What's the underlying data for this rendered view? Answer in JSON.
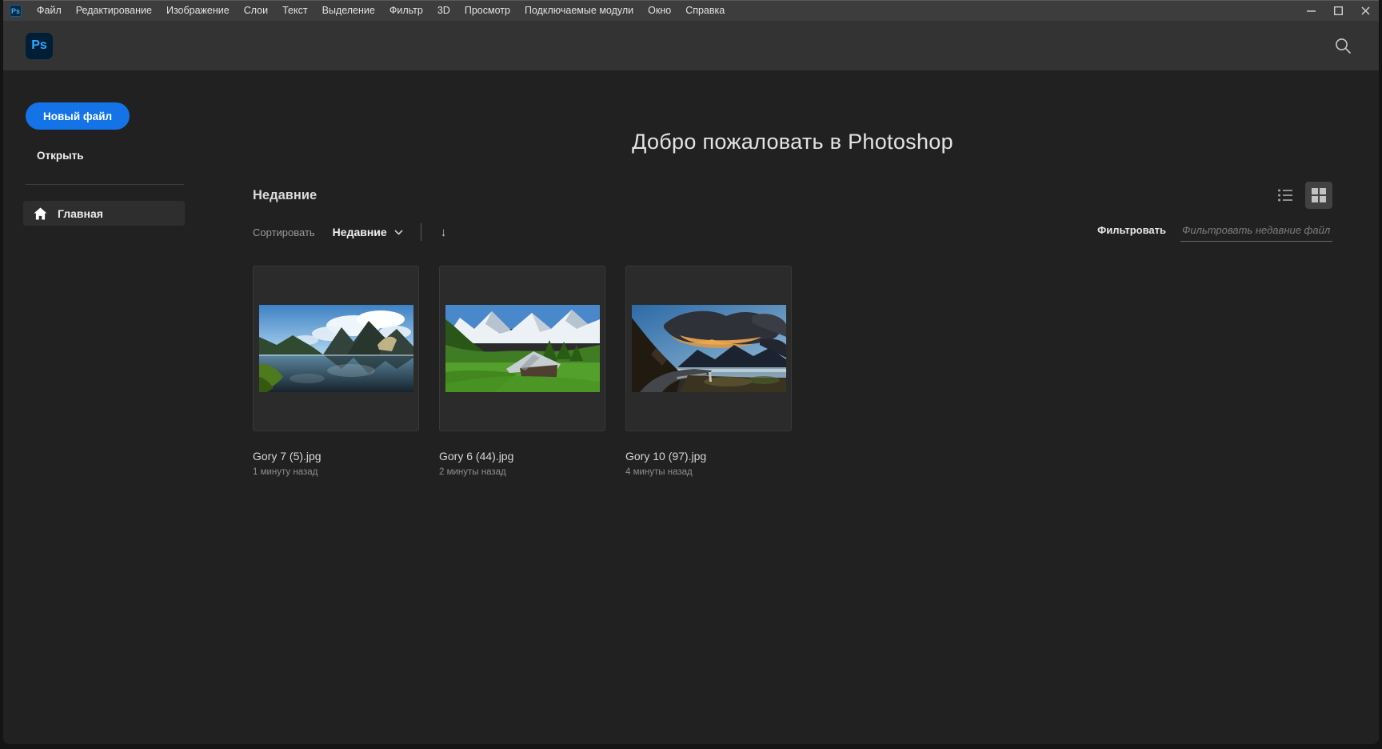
{
  "titlebar": {
    "app_badge": "Ps",
    "menu_items": [
      "Файл",
      "Редактирование",
      "Изображение",
      "Слои",
      "Текст",
      "Выделение",
      "Фильтр",
      "3D",
      "Просмотр",
      "Подключаемые модули",
      "Окно",
      "Справка"
    ]
  },
  "header": {
    "logo": "Ps"
  },
  "sidebar": {
    "new_file_label": "Новый файл",
    "open_label": "Открыть",
    "home_label": "Главная"
  },
  "main": {
    "welcome_title": "Добро пожаловать в Photoshop",
    "section_title": "Недавние",
    "sort_label": "Сортировать",
    "sort_value": "Недавние",
    "filter_label": "Фильтровать",
    "filter_placeholder": "Фильтровать недавние файл",
    "view_mode": "grid",
    "files": [
      {
        "name": "Gory 7 (5).jpg",
        "time": "1 минуту назад",
        "thumbnail": "mountain-lake-photo"
      },
      {
        "name": "Gory 6 (44).jpg",
        "time": "2 минуты назад",
        "thumbnail": "alpine-meadow-barn-photo"
      },
      {
        "name": "Gory 10 (97).jpg",
        "time": "4 минуты назад",
        "thumbnail": "sunset-clouds-road-lake-photo"
      }
    ]
  },
  "colors": {
    "accent_blue": "#1473E6",
    "ps_logo_bg": "#001E36",
    "ps_logo_text": "#31A8FF",
    "titlebar_bg": "#3D3D3D",
    "header_bg": "#333333",
    "content_bg": "#212121",
    "card_bg": "#2B2B2B"
  }
}
